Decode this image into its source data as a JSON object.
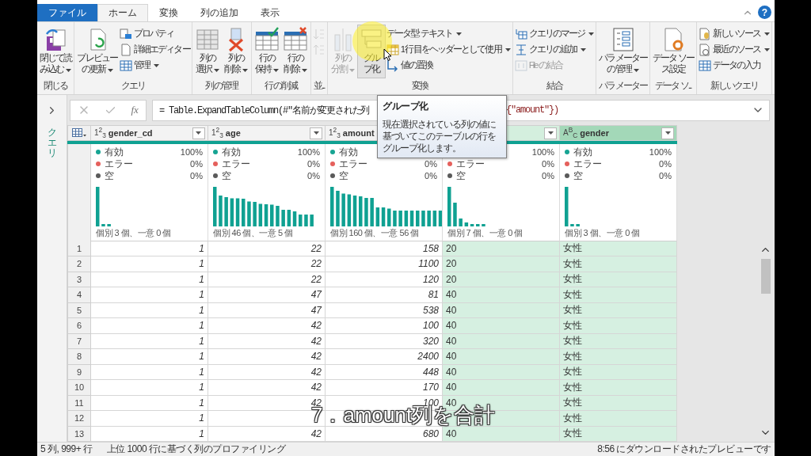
{
  "ribbon_tabs": [
    {
      "label": "ファイル",
      "kind": "file",
      "selected": false
    },
    {
      "label": "ホーム",
      "kind": "tab",
      "selected": true
    },
    {
      "label": "変換",
      "kind": "tab",
      "selected": false
    },
    {
      "label": "列の追加",
      "kind": "tab",
      "selected": false
    },
    {
      "label": "表示",
      "kind": "tab",
      "selected": false
    }
  ],
  "help": "?",
  "ribbon_groups": [
    {
      "label": "閉じる",
      "items": [
        {
          "kind": "large",
          "lines": [
            "閉じて読",
            "み込む"
          ],
          "dropdown": true,
          "disabled": false,
          "hovered": false
        }
      ]
    },
    {
      "label": "クエリ",
      "items": [
        {
          "kind": "large",
          "lines": [
            "プレビュー",
            "の更新"
          ],
          "dropdown": true,
          "disabled": false,
          "hovered": false
        },
        {
          "kind": "stack",
          "entries": [
            {
              "label": "プロパティ",
              "dropdown": false,
              "disabled": false
            },
            {
              "label": "詳細エディター",
              "dropdown": false,
              "disabled": false
            },
            {
              "label": "管理",
              "dropdown": true,
              "disabled": false
            }
          ]
        }
      ]
    },
    {
      "label": "列の管理",
      "items": [
        {
          "kind": "large",
          "lines": [
            "列の",
            "選択"
          ],
          "dropdown": true,
          "disabled": false,
          "hovered": false
        },
        {
          "kind": "large",
          "lines": [
            "列の",
            "削除"
          ],
          "dropdown": true,
          "disabled": false,
          "hovered": false
        }
      ]
    },
    {
      "label": "行の削減",
      "items": [
        {
          "kind": "large",
          "lines": [
            "行の",
            "保持"
          ],
          "dropdown": true,
          "disabled": false,
          "hovered": false
        },
        {
          "kind": "large",
          "lines": [
            "行の",
            "削除"
          ],
          "dropdown": true,
          "disabled": false,
          "hovered": false
        }
      ]
    },
    {
      "label": "並...",
      "items": [
        {
          "kind": "stack",
          "entries": [
            {
              "dropdown": false,
              "disabled": true
            },
            {
              "dropdown": false,
              "disabled": true
            }
          ]
        }
      ]
    },
    {
      "label": "変換",
      "items": [
        {
          "kind": "large",
          "lines": [
            "列の",
            "分割"
          ],
          "dropdown": true,
          "disabled": true,
          "hovered": false
        },
        {
          "kind": "large",
          "lines": [
            "グル",
            "プ化"
          ],
          "dropdown": false,
          "disabled": false,
          "hovered": true
        },
        {
          "kind": "stack",
          "entries": [
            {
              "label": "データ型: テキスト",
              "dropdown": true,
              "disabled": false
            },
            {
              "label": "1 行目をヘッダーとして使用",
              "dropdown": true,
              "disabled": false
            },
            {
              "label": "値の置換",
              "dropdown": false,
              "disabled": false
            }
          ]
        }
      ]
    },
    {
      "label": "結合",
      "items": [
        {
          "kind": "stack",
          "entries": [
            {
              "label": "クエリのマージ",
              "dropdown": true,
              "disabled": false
            },
            {
              "label": "クエリの追加",
              "dropdown": true,
              "disabled": false
            },
            {
              "label": "File の結合",
              "dropdown": false,
              "disabled": true
            }
          ]
        }
      ]
    },
    {
      "label": "パラメーター",
      "items": [
        {
          "kind": "large",
          "lines": [
            "パラメーター",
            "の管理"
          ],
          "dropdown": true,
          "disabled": false,
          "hovered": false
        }
      ]
    },
    {
      "label": "データ ソ...",
      "items": [
        {
          "kind": "large",
          "lines": [
            "データ ソー",
            "ス設定"
          ],
          "dropdown": false,
          "disabled": false,
          "hovered": false
        }
      ]
    },
    {
      "label": "新しいクエリ",
      "items": [
        {
          "kind": "stack",
          "entries": [
            {
              "label": "新しいソース",
              "dropdown": true,
              "disabled": false
            },
            {
              "label": "最近のソース",
              "dropdown": true,
              "disabled": false
            },
            {
              "label": "データの入力",
              "dropdown": false,
              "disabled": false
            }
          ]
        }
      ]
    }
  ],
  "sidebar": {
    "label": "クエリ"
  },
  "formula_bar": {
    "fx": "fx",
    "formula": "= Table.ExpandTableColumn(#\"名前が変更された列",
    "formula_tail": "{\"amount\"})"
  },
  "tooltip": {
    "title": "グループ化",
    "text": "現在選択されている列の値に基づいてこのテーブルの行をグループ化します。"
  },
  "columns": [
    {
      "type_icon": "1$^{2}$$_{3}$",
      "name": "gender_cd",
      "kind": "number",
      "selected": false,
      "active": false,
      "stats": [
        {
          "label": "有効",
          "value": "100%",
          "color": "#17a493"
        },
        {
          "label": "エラー",
          "value": "0%",
          "color": "#e5605c"
        },
        {
          "label": "空",
          "value": "0%",
          "color": "#5a5a5a"
        }
      ],
      "summary": "個別 3 個、一意 0 個"
    },
    {
      "type_icon": "1$^{2}$$_{3}$",
      "name": "age",
      "kind": "number",
      "selected": false,
      "active": false,
      "stats": [
        {
          "label": "有効",
          "value": "100%",
          "color": "#17a493"
        },
        {
          "label": "エラー",
          "value": "0%",
          "color": "#e5605c"
        },
        {
          "label": "空",
          "value": "0%",
          "color": "#5a5a5a"
        }
      ],
      "summary": "個別 46 個、一意 5 個"
    },
    {
      "type_icon": "1$^{2}$$_{3}$",
      "name": "amount",
      "kind": "number",
      "selected": false,
      "active": false,
      "stats": [
        {
          "label": "有効",
          "color": "#17a493"
        },
        {
          "label": "エラー",
          "value": "0%",
          "color": "#e5605c"
        },
        {
          "label": "空",
          "value": "0%",
          "color": "#5a5a5a"
        }
      ],
      "summary": "個別 160 個、一意 56 個"
    },
    {
      "kind": "text",
      "selected": true,
      "active": false,
      "stats": [
        {
          "value": "100%"
        },
        {
          "label": "エラー",
          "value": "0%",
          "color": "#e5605c"
        },
        {
          "label": "空",
          "value": "0%",
          "color": "#5a5a5a"
        }
      ],
      "summary": "個別 7 個、一意 0 個"
    },
    {
      "type_icon": "A$^{B}$$_{C}$",
      "name": "gender",
      "kind": "text",
      "selected": true,
      "active": true,
      "stats": [
        {
          "label": "有効",
          "value": "100%",
          "color": "#17a493"
        },
        {
          "label": "エラー",
          "value": "0%",
          "color": "#e5605c"
        },
        {
          "label": "空",
          "value": "0%",
          "color": "#5a5a5a"
        }
      ],
      "summary": "個別 3 個、一意 0 個"
    }
  ],
  "rows": [
    {
      "number": "1",
      "cells": [
        "1",
        "22",
        "158",
        "20",
        "女性"
      ]
    },
    {
      "number": "2",
      "cells": [
        "1",
        "22",
        "1100",
        "20",
        "女性"
      ]
    },
    {
      "number": "3",
      "cells": [
        "1",
        "22",
        "120",
        "20",
        "女性"
      ]
    },
    {
      "number": "4",
      "cells": [
        "1",
        "47",
        "81",
        "40",
        "女性"
      ]
    },
    {
      "number": "5",
      "cells": [
        "1",
        "47",
        "538",
        "40",
        "女性"
      ]
    },
    {
      "number": "6",
      "cells": [
        "1",
        "42",
        "100",
        "40",
        "女性"
      ]
    },
    {
      "number": "7",
      "cells": [
        "1",
        "42",
        "320",
        "40",
        "女性"
      ]
    },
    {
      "number": "8",
      "cells": [
        "1",
        "42",
        "2400",
        "40",
        "女性"
      ]
    },
    {
      "number": "9",
      "cells": [
        "1",
        "42",
        "448",
        "40",
        "女性"
      ]
    },
    {
      "number": "10",
      "cells": [
        "1",
        "42",
        "170",
        "40",
        "女性"
      ]
    },
    {
      "number": "11",
      "cells": [
        "1",
        "42",
        "100",
        "40",
        "女性"
      ]
    },
    {
      "number": "12",
      "cells": [
        "1",
        null,
        null,
        null,
        "女性"
      ]
    },
    {
      "number": "13",
      "cells": [
        "1",
        "42",
        "680",
        "40",
        "女性"
      ]
    }
  ],
  "status_bar": {
    "size": "5 列, 999+ 行",
    "profiling": "上位 1000 行に基づく列のプロファイリング",
    "preview": "8:56 にダウンロードされたプレビューです"
  },
  "caption": "7．amount列を合計"
}
